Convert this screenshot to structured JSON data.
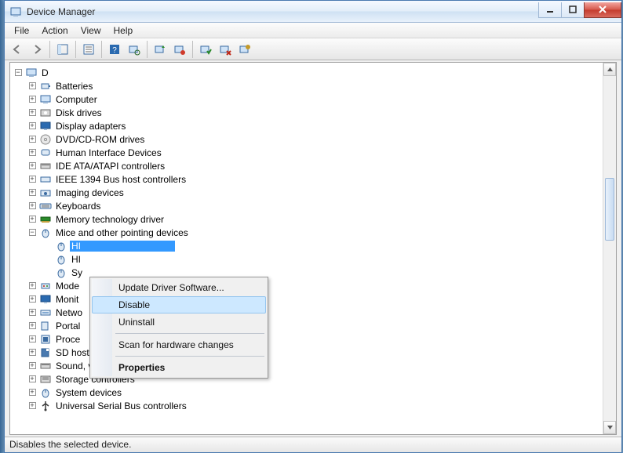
{
  "window": {
    "title": "Device Manager"
  },
  "menu": {
    "file": "File",
    "action": "Action",
    "view": "View",
    "help": "Help"
  },
  "tree": {
    "root": "D",
    "categories": [
      {
        "label": "Batteries",
        "expanded": false
      },
      {
        "label": "Computer",
        "expanded": false
      },
      {
        "label": "Disk drives",
        "expanded": false
      },
      {
        "label": "Display adapters",
        "expanded": false
      },
      {
        "label": "DVD/CD-ROM drives",
        "expanded": false
      },
      {
        "label": "Human Interface Devices",
        "expanded": false
      },
      {
        "label": "IDE ATA/ATAPI controllers",
        "expanded": false
      },
      {
        "label": "IEEE 1394 Bus host controllers",
        "expanded": false
      },
      {
        "label": "Imaging devices",
        "expanded": false
      },
      {
        "label": "Keyboards",
        "expanded": false
      },
      {
        "label": "Memory technology driver",
        "expanded": false
      },
      {
        "label": "Mice and other pointing devices",
        "expanded": true,
        "children": [
          {
            "label": "HI",
            "selected": true
          },
          {
            "label": "HI"
          },
          {
            "label": "Sy"
          }
        ]
      },
      {
        "label": "Mode",
        "expanded": false
      },
      {
        "label": "Monit",
        "expanded": false
      },
      {
        "label": "Netwo",
        "expanded": false
      },
      {
        "label": "Portal",
        "expanded": false
      },
      {
        "label": "Proce",
        "expanded": false
      },
      {
        "label": "SD host adapters",
        "expanded": false
      },
      {
        "label": "Sound, video and game controllers",
        "expanded": false
      },
      {
        "label": "Storage controllers",
        "expanded": false
      },
      {
        "label": "System devices",
        "expanded": false
      },
      {
        "label": "Universal Serial Bus controllers",
        "expanded": false
      }
    ]
  },
  "context_menu": {
    "update": "Update Driver Software...",
    "disable": "Disable",
    "uninstall": "Uninstall",
    "scan": "Scan for hardware changes",
    "properties": "Properties"
  },
  "status": "Disables the selected device."
}
